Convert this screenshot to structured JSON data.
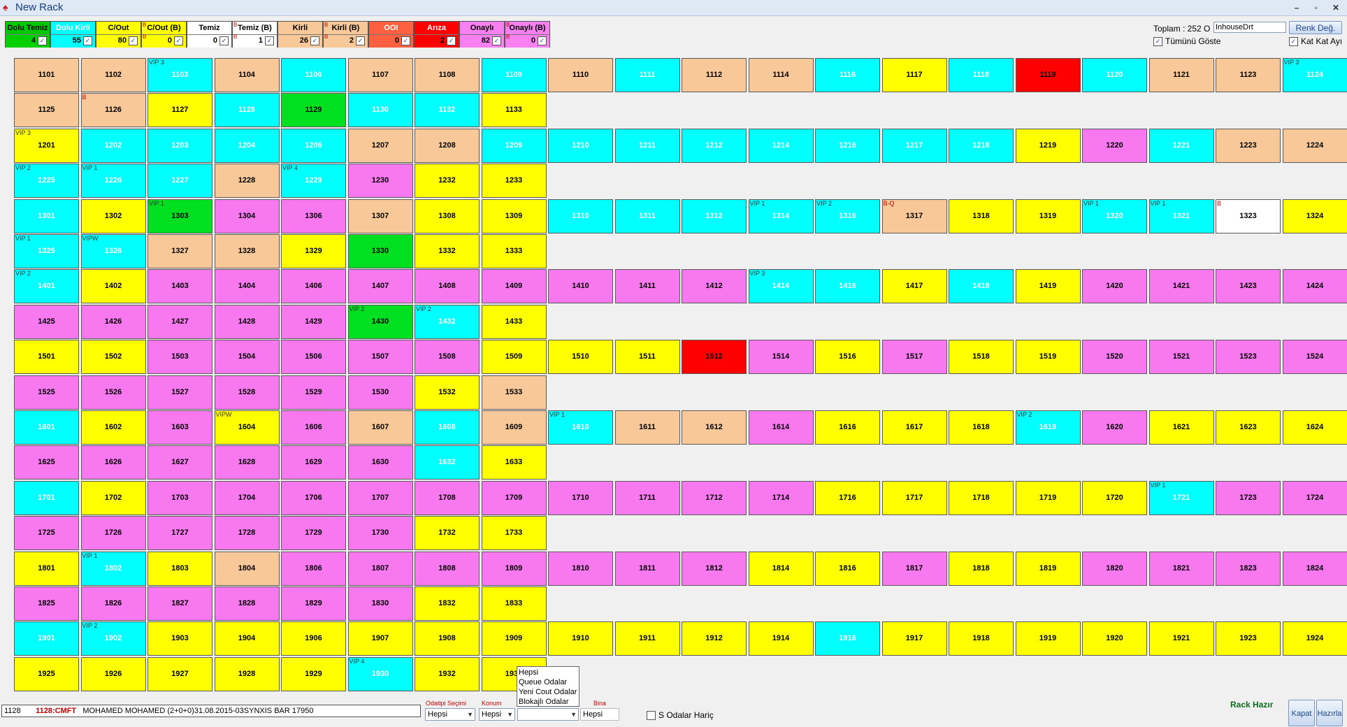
{
  "window": {
    "title": "New Rack"
  },
  "filters": [
    {
      "label": "Dolu Temiz",
      "count": "4",
      "b": false,
      "head_bg": "#00c800",
      "body_bg": "#00d000",
      "head_color": "#000"
    },
    {
      "label": "Dolu Kirli",
      "count": "55",
      "b": false,
      "head_bg": "#00ffff",
      "body_bg": "#00ffff",
      "head_color": "#ffffff"
    },
    {
      "label": "C/Out",
      "count": "80",
      "b": false,
      "head_bg": "#ffff00",
      "body_bg": "#ffff00",
      "head_color": "#000"
    },
    {
      "label": "C/Out (B)",
      "count": "0",
      "b": true,
      "head_bg": "#ffff00",
      "body_bg": "#ffff00",
      "head_color": "#000"
    },
    {
      "label": "Temiz",
      "count": "0",
      "b": false,
      "head_bg": "#ffffff",
      "body_bg": "#ffffff",
      "head_color": "#000"
    },
    {
      "label": "Temiz (B)",
      "count": "1",
      "b": true,
      "head_bg": "#ffffff",
      "body_bg": "#ffffff",
      "head_color": "#000"
    },
    {
      "label": "Kirli",
      "count": "26",
      "b": false,
      "head_bg": "#f8c898",
      "body_bg": "#f8c898",
      "head_color": "#000"
    },
    {
      "label": "Kirli (B)",
      "count": "2",
      "b": true,
      "head_bg": "#f8c898",
      "body_bg": "#f8c898",
      "head_color": "#000"
    },
    {
      "label": "OOI",
      "count": "0",
      "b": false,
      "head_bg": "#ff6040",
      "body_bg": "#ff6040",
      "head_color": "#ffffff"
    },
    {
      "label": "Arıza",
      "count": "2",
      "b": false,
      "head_bg": "#ff0000",
      "body_bg": "#ff0000",
      "head_color": "#ffffff"
    },
    {
      "label": "Onaylı",
      "count": "82",
      "b": false,
      "head_bg": "#f880f0",
      "body_bg": "#f880f0",
      "head_color": "#000"
    },
    {
      "label": "Onaylı (B)",
      "count": "0",
      "b": true,
      "head_bg": "#f880f0",
      "body_bg": "#f880f0",
      "head_color": "#000"
    }
  ],
  "right_panel": {
    "total_label": "Toplam : 252 O",
    "search_value": "InhouseDrt",
    "color_change_button": "Renk Değ.",
    "show_all_label": "Tümünü Göste",
    "floor_by_floor_label": "Kat Kat Ayı"
  },
  "colors": {
    "K": "#f8c898",
    "C": "#00ffff",
    "Y": "#ffff00",
    "G": "#00e020",
    "R": "#ff0000",
    "M": "#f878f0",
    "W": "#ffffff"
  },
  "rows": [
    [
      [
        "1101",
        "K",
        ""
      ],
      [
        "1102",
        "K",
        ""
      ],
      [
        "1103",
        "C",
        "VIP 3"
      ],
      [
        "1104",
        "K",
        ""
      ],
      [
        "1106",
        "C",
        ""
      ],
      [
        "1107",
        "K",
        ""
      ],
      [
        "1108",
        "K",
        ""
      ],
      [
        "1109",
        "C",
        ""
      ],
      [
        "1110",
        "K",
        ""
      ],
      [
        "1111",
        "C",
        ""
      ],
      [
        "1112",
        "K",
        ""
      ],
      [
        "1114",
        "K",
        ""
      ],
      [
        "1116",
        "C",
        ""
      ],
      [
        "1117",
        "Y",
        ""
      ],
      [
        "1118",
        "C",
        ""
      ],
      [
        "1119",
        "R",
        ""
      ],
      [
        "1120",
        "C",
        ""
      ],
      [
        "1121",
        "K",
        ""
      ],
      [
        "1123",
        "K",
        ""
      ],
      [
        "1124",
        "C",
        "VIP 3"
      ]
    ],
    [
      [
        "1125",
        "K",
        ""
      ],
      [
        "1126",
        "K",
        "B"
      ],
      [
        "1127",
        "Y",
        ""
      ],
      [
        "1128",
        "C",
        ""
      ],
      [
        "1129",
        "G",
        ""
      ],
      [
        "1130",
        "C",
        ""
      ],
      [
        "1132",
        "C",
        ""
      ],
      [
        "1133",
        "Y",
        ""
      ]
    ],
    [
      [
        "1201",
        "Y",
        "VIP 3"
      ],
      [
        "1202",
        "C",
        ""
      ],
      [
        "1203",
        "C",
        ""
      ],
      [
        "1204",
        "C",
        ""
      ],
      [
        "1206",
        "C",
        ""
      ],
      [
        "1207",
        "K",
        ""
      ],
      [
        "1208",
        "K",
        ""
      ],
      [
        "1209",
        "C",
        ""
      ],
      [
        "1210",
        "C",
        ""
      ],
      [
        "1211",
        "C",
        ""
      ],
      [
        "1212",
        "C",
        ""
      ],
      [
        "1214",
        "C",
        ""
      ],
      [
        "1216",
        "C",
        ""
      ],
      [
        "1217",
        "C",
        ""
      ],
      [
        "1218",
        "C",
        ""
      ],
      [
        "1219",
        "Y",
        ""
      ],
      [
        "1220",
        "M",
        ""
      ],
      [
        "1221",
        "C",
        ""
      ],
      [
        "1223",
        "K",
        ""
      ],
      [
        "1224",
        "K",
        ""
      ]
    ],
    [
      [
        "1225",
        "C",
        "VIP 2"
      ],
      [
        "1226",
        "C",
        "VIP 1"
      ],
      [
        "1227",
        "C",
        ""
      ],
      [
        "1228",
        "K",
        ""
      ],
      [
        "1229",
        "C",
        "VIP 4"
      ],
      [
        "1230",
        "M",
        ""
      ],
      [
        "1232",
        "Y",
        ""
      ],
      [
        "1233",
        "Y",
        ""
      ]
    ],
    [
      [
        "1301",
        "C",
        ""
      ],
      [
        "1302",
        "Y",
        ""
      ],
      [
        "1303",
        "G",
        "VIP 1"
      ],
      [
        "1304",
        "M",
        ""
      ],
      [
        "1306",
        "M",
        ""
      ],
      [
        "1307",
        "K",
        ""
      ],
      [
        "1308",
        "Y",
        ""
      ],
      [
        "1309",
        "Y",
        ""
      ],
      [
        "1310",
        "C",
        ""
      ],
      [
        "1311",
        "C",
        ""
      ],
      [
        "1312",
        "C",
        ""
      ],
      [
        "1314",
        "C",
        "VIP 1"
      ],
      [
        "1316",
        "C",
        "VIP 2"
      ],
      [
        "1317",
        "K",
        "B-Q"
      ],
      [
        "1318",
        "Y",
        ""
      ],
      [
        "1319",
        "Y",
        ""
      ],
      [
        "1320",
        "C",
        "VIP 1"
      ],
      [
        "1321",
        "C",
        "VIP 1"
      ],
      [
        "1323",
        "W",
        "B"
      ],
      [
        "1324",
        "Y",
        ""
      ]
    ],
    [
      [
        "1325",
        "C",
        "VIP 1"
      ],
      [
        "1326",
        "C",
        "VIPW"
      ],
      [
        "1327",
        "K",
        ""
      ],
      [
        "1328",
        "K",
        ""
      ],
      [
        "1329",
        "Y",
        ""
      ],
      [
        "1330",
        "G",
        ""
      ],
      [
        "1332",
        "Y",
        ""
      ],
      [
        "1333",
        "Y",
        ""
      ]
    ],
    [
      [
        "1401",
        "C",
        "VIP 2"
      ],
      [
        "1402",
        "Y",
        ""
      ],
      [
        "1403",
        "M",
        ""
      ],
      [
        "1404",
        "M",
        ""
      ],
      [
        "1406",
        "M",
        ""
      ],
      [
        "1407",
        "M",
        ""
      ],
      [
        "1408",
        "M",
        ""
      ],
      [
        "1409",
        "M",
        ""
      ],
      [
        "1410",
        "M",
        ""
      ],
      [
        "1411",
        "M",
        ""
      ],
      [
        "1412",
        "M",
        ""
      ],
      [
        "1414",
        "C",
        "VIP 3"
      ],
      [
        "1416",
        "C",
        ""
      ],
      [
        "1417",
        "Y",
        ""
      ],
      [
        "1418",
        "C",
        ""
      ],
      [
        "1419",
        "Y",
        ""
      ],
      [
        "1420",
        "M",
        ""
      ],
      [
        "1421",
        "M",
        ""
      ],
      [
        "1423",
        "M",
        ""
      ],
      [
        "1424",
        "M",
        ""
      ]
    ],
    [
      [
        "1425",
        "M",
        ""
      ],
      [
        "1426",
        "M",
        ""
      ],
      [
        "1427",
        "M",
        ""
      ],
      [
        "1428",
        "M",
        ""
      ],
      [
        "1429",
        "M",
        ""
      ],
      [
        "1430",
        "G",
        "VIP 2"
      ],
      [
        "1432",
        "C",
        "VIP 2"
      ],
      [
        "1433",
        "Y",
        ""
      ]
    ],
    [
      [
        "1501",
        "Y",
        ""
      ],
      [
        "1502",
        "Y",
        ""
      ],
      [
        "1503",
        "M",
        ""
      ],
      [
        "1504",
        "M",
        ""
      ],
      [
        "1506",
        "M",
        ""
      ],
      [
        "1507",
        "M",
        ""
      ],
      [
        "1508",
        "M",
        ""
      ],
      [
        "1509",
        "Y",
        ""
      ],
      [
        "1510",
        "Y",
        ""
      ],
      [
        "1511",
        "Y",
        ""
      ],
      [
        "1512",
        "R",
        ""
      ],
      [
        "1514",
        "M",
        ""
      ],
      [
        "1516",
        "Y",
        ""
      ],
      [
        "1517",
        "M",
        ""
      ],
      [
        "1518",
        "Y",
        ""
      ],
      [
        "1519",
        "Y",
        ""
      ],
      [
        "1520",
        "M",
        ""
      ],
      [
        "1521",
        "M",
        ""
      ],
      [
        "1523",
        "M",
        ""
      ],
      [
        "1524",
        "M",
        ""
      ]
    ],
    [
      [
        "1525",
        "M",
        ""
      ],
      [
        "1526",
        "M",
        ""
      ],
      [
        "1527",
        "M",
        ""
      ],
      [
        "1528",
        "M",
        ""
      ],
      [
        "1529",
        "M",
        ""
      ],
      [
        "1530",
        "M",
        ""
      ],
      [
        "1532",
        "Y",
        ""
      ],
      [
        "1533",
        "K",
        ""
      ]
    ],
    [
      [
        "1601",
        "C",
        ""
      ],
      [
        "1602",
        "Y",
        ""
      ],
      [
        "1603",
        "M",
        ""
      ],
      [
        "1604",
        "Y",
        "VIPW"
      ],
      [
        "1606",
        "M",
        ""
      ],
      [
        "1607",
        "K",
        ""
      ],
      [
        "1608",
        "C",
        ""
      ],
      [
        "1609",
        "K",
        ""
      ],
      [
        "1610",
        "C",
        "VIP 1"
      ],
      [
        "1611",
        "K",
        ""
      ],
      [
        "1612",
        "K",
        ""
      ],
      [
        "1614",
        "M",
        ""
      ],
      [
        "1616",
        "Y",
        ""
      ],
      [
        "1617",
        "Y",
        ""
      ],
      [
        "1618",
        "Y",
        ""
      ],
      [
        "1619",
        "C",
        "VIP 2"
      ],
      [
        "1620",
        "M",
        ""
      ],
      [
        "1621",
        "Y",
        ""
      ],
      [
        "1623",
        "Y",
        ""
      ],
      [
        "1624",
        "Y",
        ""
      ]
    ],
    [
      [
        "1625",
        "M",
        ""
      ],
      [
        "1626",
        "M",
        ""
      ],
      [
        "1627",
        "M",
        ""
      ],
      [
        "1628",
        "M",
        ""
      ],
      [
        "1629",
        "M",
        ""
      ],
      [
        "1630",
        "M",
        ""
      ],
      [
        "1632",
        "C",
        ""
      ],
      [
        "1633",
        "Y",
        ""
      ]
    ],
    [
      [
        "1701",
        "C",
        ""
      ],
      [
        "1702",
        "Y",
        ""
      ],
      [
        "1703",
        "M",
        ""
      ],
      [
        "1704",
        "M",
        ""
      ],
      [
        "1706",
        "M",
        ""
      ],
      [
        "1707",
        "M",
        ""
      ],
      [
        "1708",
        "M",
        ""
      ],
      [
        "1709",
        "M",
        ""
      ],
      [
        "1710",
        "M",
        ""
      ],
      [
        "1711",
        "M",
        ""
      ],
      [
        "1712",
        "M",
        ""
      ],
      [
        "1714",
        "M",
        ""
      ],
      [
        "1716",
        "Y",
        ""
      ],
      [
        "1717",
        "Y",
        ""
      ],
      [
        "1718",
        "Y",
        ""
      ],
      [
        "1719",
        "Y",
        ""
      ],
      [
        "1720",
        "Y",
        ""
      ],
      [
        "1721",
        "C",
        "VIP 1"
      ],
      [
        "1723",
        "M",
        ""
      ],
      [
        "1724",
        "M",
        ""
      ]
    ],
    [
      [
        "1725",
        "M",
        ""
      ],
      [
        "1726",
        "M",
        ""
      ],
      [
        "1727",
        "M",
        ""
      ],
      [
        "1728",
        "M",
        ""
      ],
      [
        "1729",
        "M",
        ""
      ],
      [
        "1730",
        "M",
        ""
      ],
      [
        "1732",
        "Y",
        ""
      ],
      [
        "1733",
        "Y",
        ""
      ]
    ],
    [
      [
        "1801",
        "Y",
        ""
      ],
      [
        "1802",
        "C",
        "VIP 1"
      ],
      [
        "1803",
        "Y",
        ""
      ],
      [
        "1804",
        "K",
        ""
      ],
      [
        "1806",
        "M",
        ""
      ],
      [
        "1807",
        "M",
        ""
      ],
      [
        "1808",
        "M",
        ""
      ],
      [
        "1809",
        "M",
        ""
      ],
      [
        "1810",
        "M",
        ""
      ],
      [
        "1811",
        "M",
        ""
      ],
      [
        "1812",
        "M",
        ""
      ],
      [
        "1814",
        "Y",
        ""
      ],
      [
        "1816",
        "Y",
        ""
      ],
      [
        "1817",
        "M",
        ""
      ],
      [
        "1818",
        "Y",
        ""
      ],
      [
        "1819",
        "Y",
        ""
      ],
      [
        "1820",
        "M",
        ""
      ],
      [
        "1821",
        "M",
        ""
      ],
      [
        "1823",
        "M",
        ""
      ],
      [
        "1824",
        "M",
        ""
      ]
    ],
    [
      [
        "1825",
        "M",
        ""
      ],
      [
        "1826",
        "M",
        ""
      ],
      [
        "1827",
        "M",
        ""
      ],
      [
        "1828",
        "M",
        ""
      ],
      [
        "1829",
        "M",
        ""
      ],
      [
        "1830",
        "M",
        ""
      ],
      [
        "1832",
        "Y",
        ""
      ],
      [
        "1833",
        "Y",
        ""
      ]
    ],
    [
      [
        "1901",
        "C",
        ""
      ],
      [
        "1902",
        "C",
        "VIP 2"
      ],
      [
        "1903",
        "Y",
        ""
      ],
      [
        "1904",
        "Y",
        ""
      ],
      [
        "1906",
        "Y",
        ""
      ],
      [
        "1907",
        "Y",
        ""
      ],
      [
        "1908",
        "Y",
        ""
      ],
      [
        "1909",
        "Y",
        ""
      ],
      [
        "1910",
        "Y",
        ""
      ],
      [
        "1911",
        "Y",
        ""
      ],
      [
        "1912",
        "Y",
        ""
      ],
      [
        "1914",
        "Y",
        ""
      ],
      [
        "1916",
        "C",
        ""
      ],
      [
        "1917",
        "Y",
        ""
      ],
      [
        "1918",
        "Y",
        ""
      ],
      [
        "1919",
        "Y",
        ""
      ],
      [
        "1920",
        "Y",
        ""
      ],
      [
        "1921",
        "Y",
        ""
      ],
      [
        "1923",
        "Y",
        ""
      ],
      [
        "1924",
        "Y",
        ""
      ]
    ],
    [
      [
        "1925",
        "Y",
        ""
      ],
      [
        "1926",
        "Y",
        ""
      ],
      [
        "1927",
        "Y",
        ""
      ],
      [
        "1928",
        "Y",
        ""
      ],
      [
        "1929",
        "Y",
        ""
      ],
      [
        "1930",
        "C",
        "VIP 4"
      ],
      [
        "1932",
        "Y",
        ""
      ],
      [
        "1933",
        "Y",
        ""
      ]
    ]
  ],
  "bottom": {
    "info_room": "1128",
    "info_code": "1128:CMFT",
    "info_text": "MOHAMED MOHAMED   (2+0+0)31.08.2015-03SYNXIS BAR        17950",
    "room_select_label": "Odatipi Seçimi",
    "room_select_value": "Hepsi",
    "location_label": "Konum",
    "location_value": "Hepsi",
    "type_select_value": "",
    "building_label": "Bina",
    "building_value": "Hepsi",
    "exclude_label": "S Odalar Hariç",
    "dropdown_options": [
      "Hepsi",
      "Queue Odalar",
      "Yeni Cout Odalar",
      "Blokajlı Odalar"
    ],
    "status_text": "Rack Hazır",
    "close_button": "Kapat",
    "prepare_button": "Hazırla"
  }
}
